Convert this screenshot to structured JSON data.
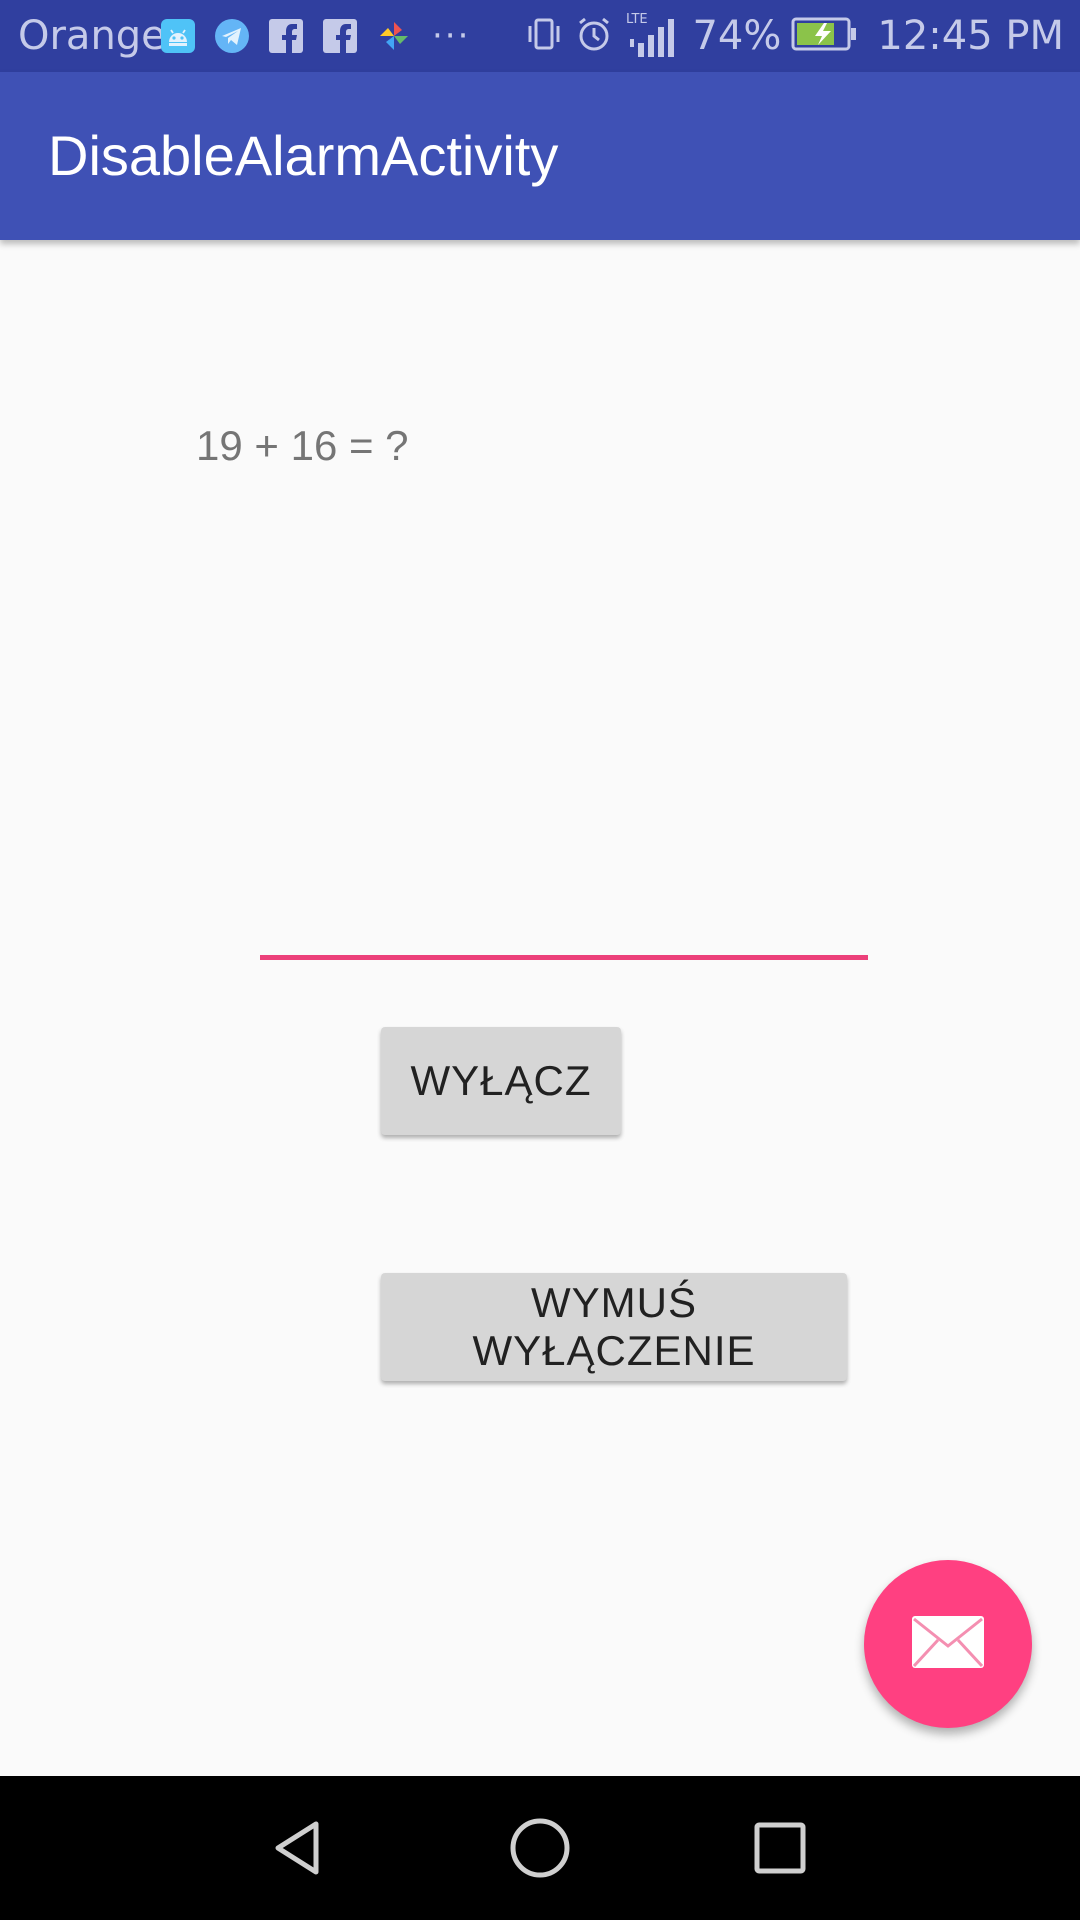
{
  "status_bar": {
    "carrier": "Orange",
    "notification_icons": [
      "android-debug-icon",
      "telegram-icon",
      "facebook-icon",
      "facebook-icon",
      "pinwheel-icon"
    ],
    "more_indicator": "···",
    "network_label": "LTE",
    "battery_percent": "74%",
    "time": "12:45 PM"
  },
  "app_bar": {
    "title": "DisableAlarmActivity"
  },
  "main": {
    "question": "19 + 16 = ?",
    "answer_value": "",
    "answer_placeholder": "",
    "disable_button": "WYŁĄCZ",
    "force_disable_button": "WYMUŚ WYŁĄCZENIE"
  },
  "fab": {
    "icon": "mail-icon"
  },
  "colors": {
    "status_bar": "#303f9f",
    "app_bar": "#3f51b5",
    "accent": "#ff4081",
    "input_underline": "#ec407a",
    "button": "#d6d6d6",
    "background": "#fafafa"
  }
}
